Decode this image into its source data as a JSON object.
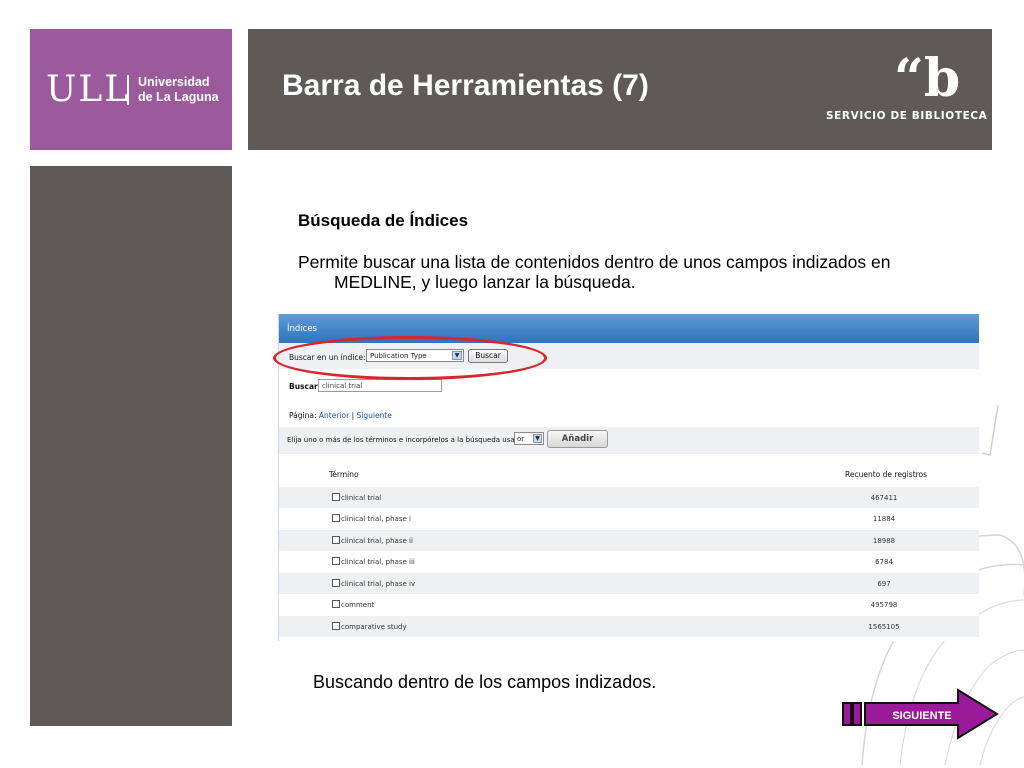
{
  "logo": {
    "mark": "ULL",
    "line1": "Universidad",
    "line2": "de La Laguna"
  },
  "header": {
    "title": "Barra de Herramientas (7)",
    "library_mark": "“b",
    "library_text": "SERVICIO DE BIBLIOTECA"
  },
  "content": {
    "section_title": "Búsqueda de Índices",
    "description": "Permite buscar una lista de contenidos dentro de unos campos indizados en MEDLINE, y luego lanzar la búsqueda.",
    "caption": "Buscando dentro de los campos indizados."
  },
  "screenshot": {
    "panel_title": "Índices",
    "search_index_label": "Buscar en un índice:",
    "search_index_value": "Publication Type",
    "search_button": "Buscar",
    "search_label": "Buscar:",
    "search_value": "clinical trial",
    "page_label": "Página:",
    "prev_link": "Anterior",
    "page_sep": "|",
    "next_link": "Siguiente",
    "choose_text": "Elija uno o más de los términos e incorpórelos a la búsqueda usando:",
    "operator_value": "or",
    "add_button": "Añadir",
    "col_term": "Término",
    "col_count": "Recuento de registros",
    "rows": [
      {
        "term": "clinical trial",
        "count": "467411"
      },
      {
        "term": "clinical trial, phase i",
        "count": "11884"
      },
      {
        "term": "clinical trial, phase ii",
        "count": "18988"
      },
      {
        "term": "clinical trial, phase iii",
        "count": "6784"
      },
      {
        "term": "clinical trial, phase iv",
        "count": "697"
      },
      {
        "term": "comment",
        "count": "495798"
      },
      {
        "term": "comparative study",
        "count": "1565105"
      }
    ]
  },
  "nav": {
    "next_label": "SIGUIENTE"
  },
  "colors": {
    "logo_purple": "#9b5a9b",
    "header_gray": "#5f5a57",
    "highlight_red": "#d9262b",
    "next_purple": "#9a1a9a"
  }
}
